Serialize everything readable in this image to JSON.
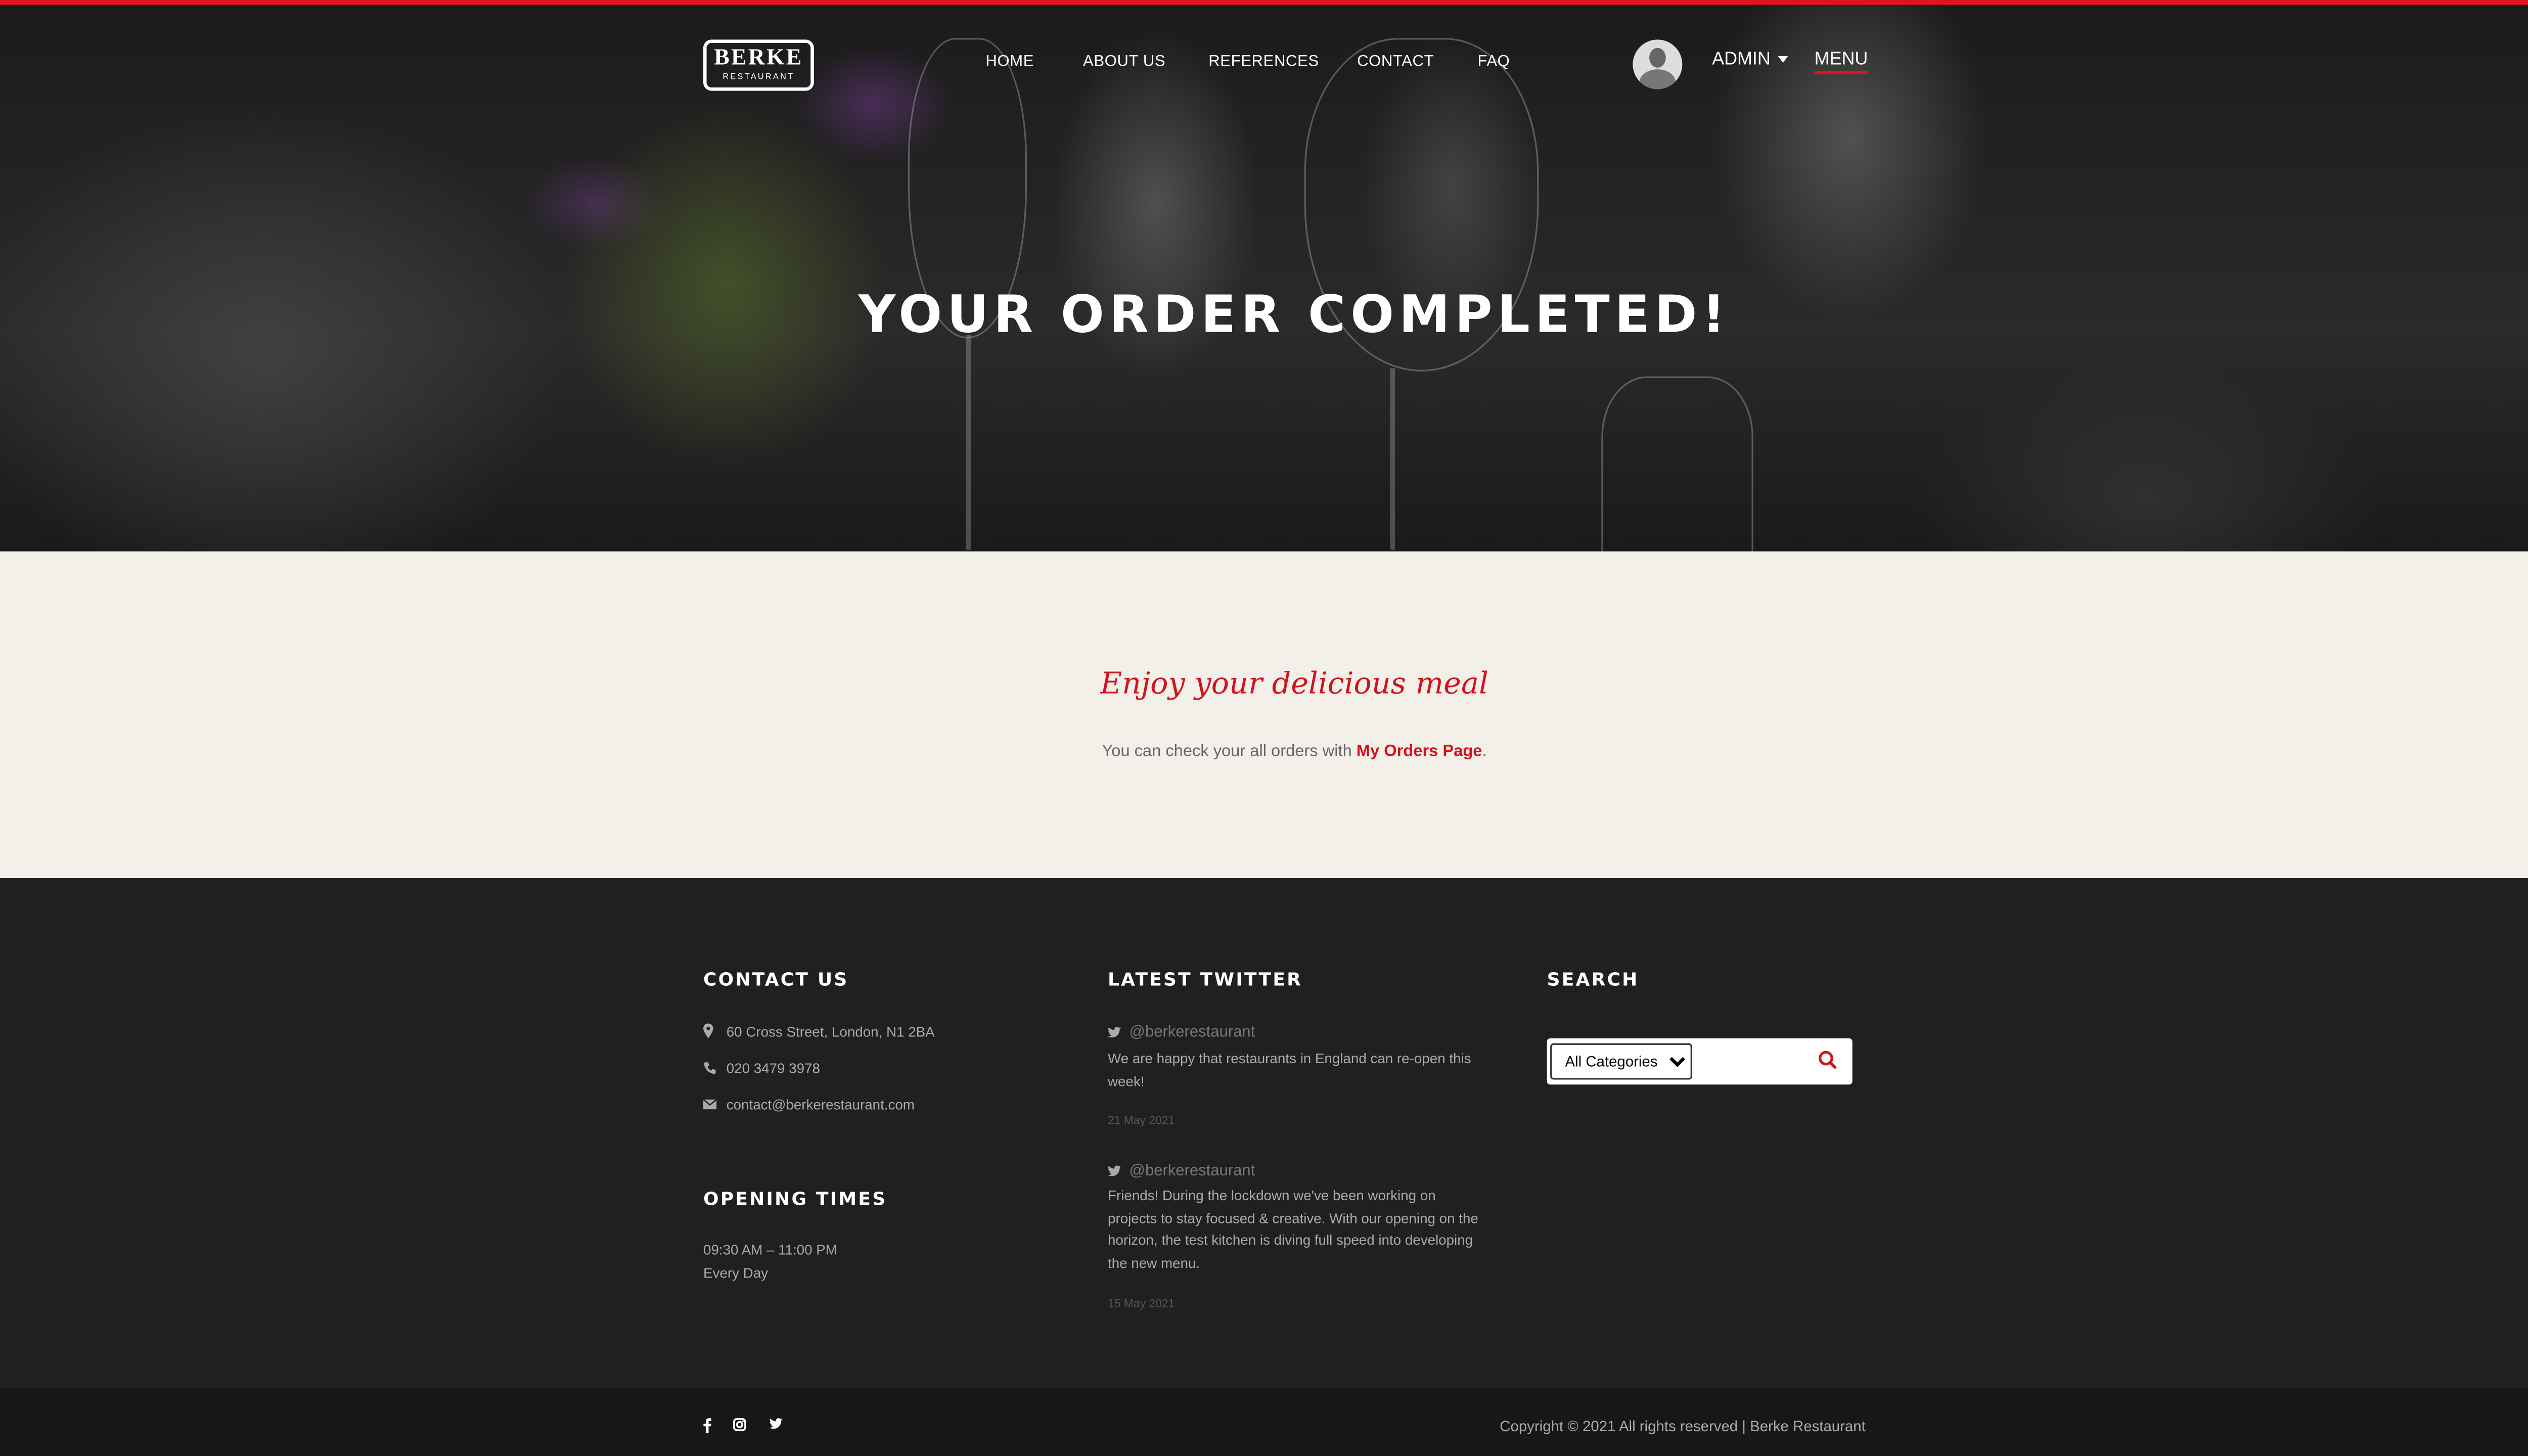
{
  "header": {
    "logo_main": "BERKE",
    "logo_sub": "RESTAURANT",
    "nav": [
      {
        "label": "HOME"
      },
      {
        "label": "ABOUT US"
      },
      {
        "label": "REFERENCES"
      },
      {
        "label": "CONTACT"
      },
      {
        "label": "FAQ"
      }
    ],
    "user_label": "ADMIN",
    "menu_label": "MENU"
  },
  "hero": {
    "title": "YOUR ORDER COMPLETED!"
  },
  "content": {
    "heading": "Enjoy your delicious meal",
    "message_prefix": "You can check your all orders with ",
    "link_label": "My Orders Page",
    "message_suffix": "."
  },
  "footer": {
    "contact": {
      "title": "CONTACT US",
      "address": "60 Cross Street, London, N1 2BA",
      "phone": "020 3479 3978",
      "email": "contact@berkerestaurant.com"
    },
    "opening": {
      "title": "OPENING TIMES",
      "hours": "09:30 AM – 11:00 PM",
      "days": "Every Day"
    },
    "twitter": {
      "title": "LATEST TWITTER",
      "tweets": [
        {
          "handle": "@berkerestaurant",
          "text": "We are happy that restaurants in England can re-open this week!",
          "date": "21 May 2021"
        },
        {
          "handle": "@berkerestaurant",
          "text": "Friends! During the lockdown we've been working on projects to stay focused & creative. With our opening on the horizon, the test kitchen is diving full speed into developing the new menu.",
          "date": "15 May 2021"
        }
      ]
    },
    "search": {
      "title": "SEARCH",
      "selected_category": "All Categories"
    },
    "copyright": "Copyright © 2021 All rights reserved | Berke Restaurant"
  },
  "icons": {
    "social": [
      "facebook-icon",
      "instagram-icon",
      "twitter-icon"
    ]
  },
  "colors": {
    "accent": "#e0141e",
    "content_bg": "#f3f0e9",
    "footer_bg": "#202020"
  }
}
